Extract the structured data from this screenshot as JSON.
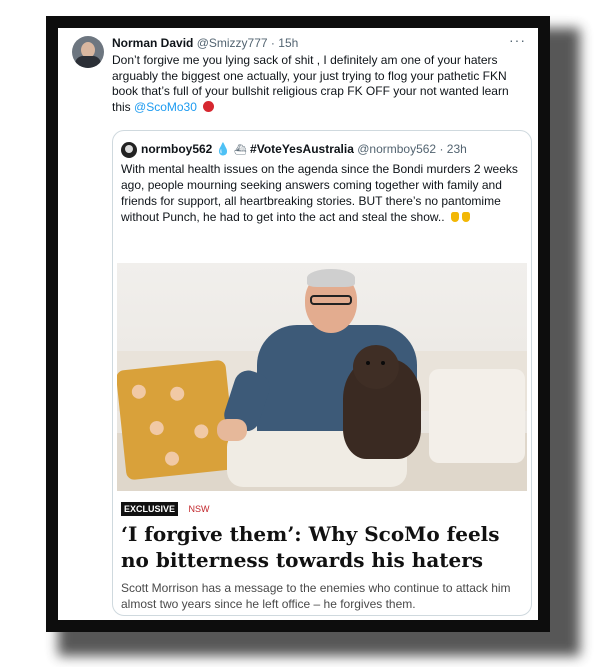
{
  "tweet": {
    "author_name": "Norman David",
    "author_handle": "@Smizzy777",
    "time": "15h",
    "more_label": "···",
    "text_main": "Don’t forgive me you lying sack of shit , I definitely am one of your haters arguably the biggest one actually, your just trying to flog your pathetic FKN book that’s full of your bullshit religious crap FK OFF  your not wanted learn this",
    "mention": "@ScoMo30"
  },
  "quoted": {
    "author_name": "normboy562",
    "tag": "#VoteYesAustralia",
    "author_handle": "@normboy562",
    "time": "23h",
    "text": "With mental health issues on the agenda since the Bondi murders 2 weeks ago, people mourning seeking answers coming together with family and friends for support, all heartbreaking stories. BUT there’s no pantomime without Punch, he had to get into the act and steal the show.."
  },
  "article": {
    "badge": "EXCLUSIVE",
    "section": "NSW",
    "headline": "‘I forgive them’: Why ScoMo feels no bitterness towards his haters",
    "summary": "Scott Morrison has a message to the enemies who continue to attack him almost two years since he left office – he forgives them."
  },
  "icons": [
    "avatar",
    "more-icon",
    "angry-emoji-icon",
    "droplet-icon",
    "ship-icon",
    "point-down-icon"
  ],
  "colors": {
    "mention": "#1d9bf0",
    "muted": "#536471",
    "section": "#c2262b"
  }
}
